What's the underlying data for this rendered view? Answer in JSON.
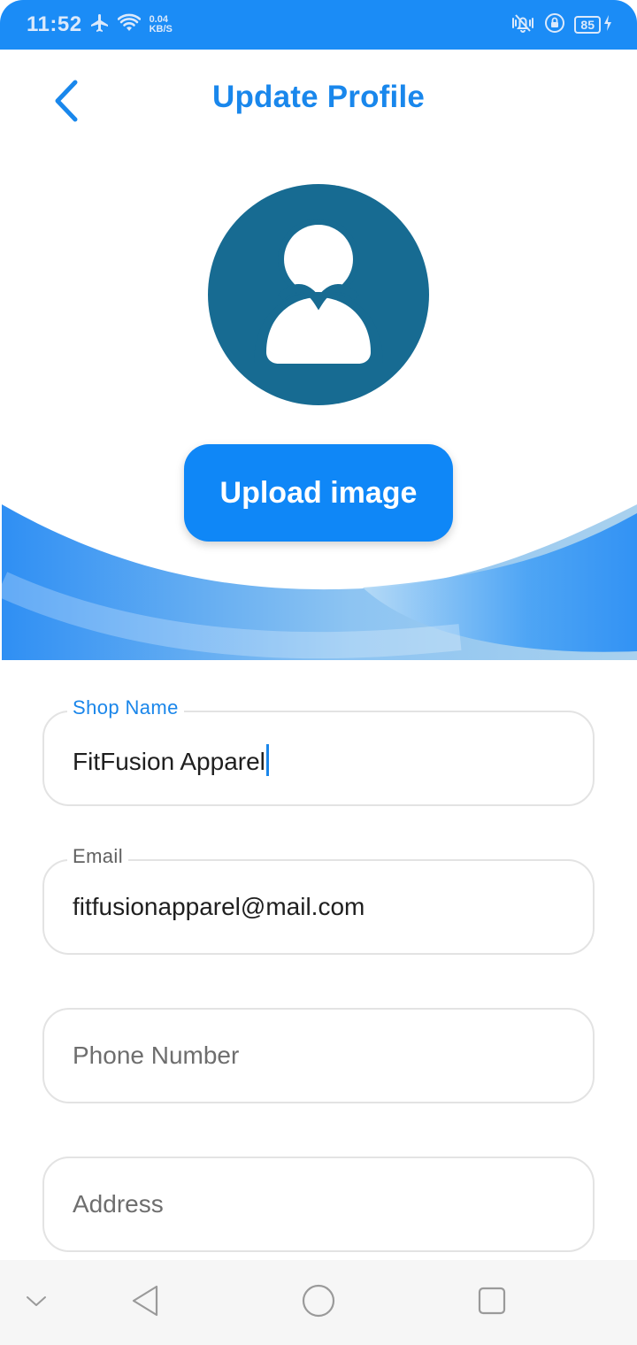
{
  "status_bar": {
    "time": "11:52",
    "net_speed_value": "0.04",
    "net_speed_unit": "KB/S",
    "battery_level": "85",
    "icons": [
      "airplane-icon",
      "wifi-icon",
      "vibrate-icon",
      "lock-rotation-icon",
      "battery-icon",
      "charging-icon"
    ]
  },
  "header": {
    "title": "Update Profile",
    "back_icon": "chevron-left-icon"
  },
  "profile": {
    "avatar_icon": "user-avatar-icon",
    "upload_label": "Upload image"
  },
  "form": {
    "shop_name": {
      "label": "Shop Name",
      "value": "FitFusion Apparel",
      "focused": true
    },
    "email": {
      "label": "Email",
      "value": "fitfusionapparel@mail.com"
    },
    "phone": {
      "placeholder": "Phone Number"
    },
    "address": {
      "placeholder": "Address"
    }
  },
  "nav_bar": {
    "items": [
      "hide-keyboard-icon",
      "back-triangle-icon",
      "home-circle-icon",
      "recents-square-icon"
    ]
  },
  "colors": {
    "primary": "#1987ec",
    "status_bar": "#1b8cf6",
    "avatar_bg": "#176b92",
    "field_border": "#e3e3e3"
  }
}
